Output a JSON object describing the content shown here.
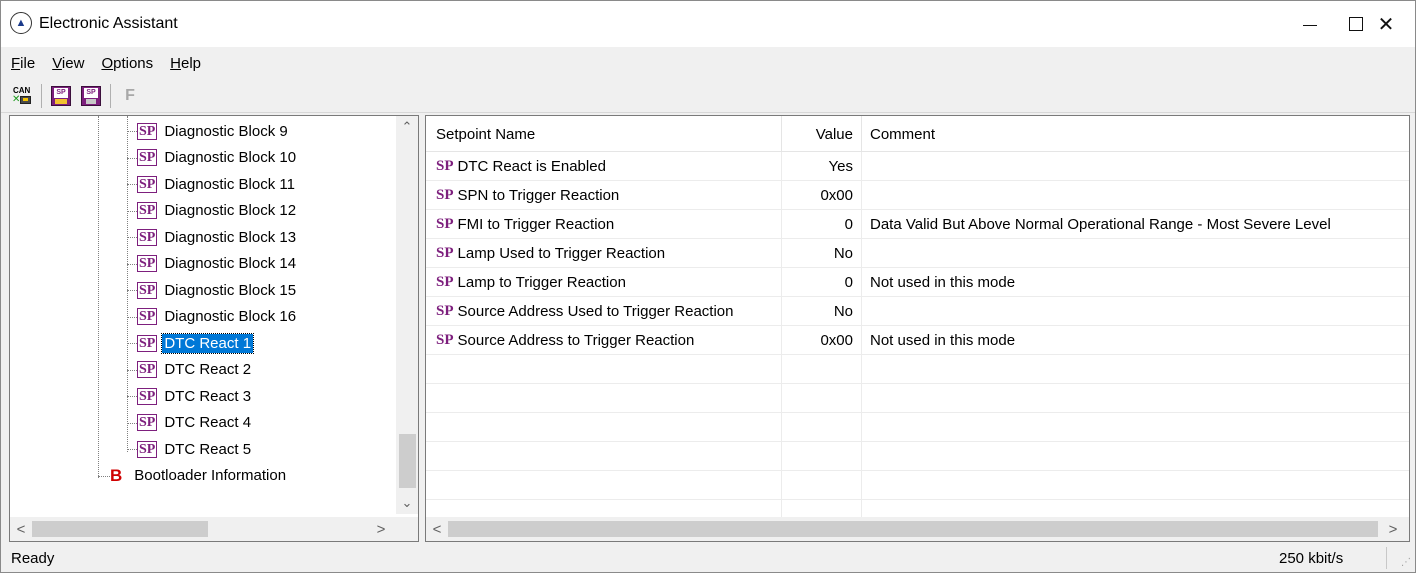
{
  "window": {
    "title": "Electronic Assistant",
    "min_glyph": "",
    "close_glyph": "✕"
  },
  "menu": [
    {
      "u": "F",
      "rest": "ile"
    },
    {
      "u": "V",
      "rest": "iew"
    },
    {
      "u": "O",
      "rest": "ptions"
    },
    {
      "u": "H",
      "rest": "elp"
    }
  ],
  "toolbar": {
    "can_label": "CAN",
    "sp_label": "SP",
    "f_label": "F"
  },
  "tree": {
    "sp_badge": "SP",
    "b_badge": "B",
    "items": [
      {
        "label": "Diagnostic Block 9"
      },
      {
        "label": "Diagnostic Block 10"
      },
      {
        "label": "Diagnostic Block 11"
      },
      {
        "label": "Diagnostic Block 12"
      },
      {
        "label": "Diagnostic Block 13"
      },
      {
        "label": "Diagnostic Block 14"
      },
      {
        "label": "Diagnostic Block 15"
      },
      {
        "label": "Diagnostic Block 16"
      },
      {
        "label": "DTC React 1"
      },
      {
        "label": "DTC React 2"
      },
      {
        "label": "DTC React 3"
      },
      {
        "label": "DTC React 4"
      },
      {
        "label": "DTC React 5"
      }
    ],
    "selected_index": 8,
    "bootloader_label": "Bootloader Information"
  },
  "grid": {
    "columns": {
      "name": "Setpoint Name",
      "value": "Value",
      "comment": "Comment"
    },
    "sp_badge": "SP",
    "rows": [
      {
        "name": "DTC React is Enabled",
        "value": "Yes",
        "comment": ""
      },
      {
        "name": "SPN to Trigger Reaction",
        "value": "0x00",
        "comment": ""
      },
      {
        "name": "FMI to Trigger Reaction",
        "value": "0",
        "comment": "Data Valid But Above Normal Operational Range - Most Severe Level"
      },
      {
        "name": "Lamp Used to Trigger Reaction",
        "value": "No",
        "comment": ""
      },
      {
        "name": "Lamp to Trigger Reaction",
        "value": "0",
        "comment": "Not used in this mode"
      },
      {
        "name": "Source Address Used to Trigger Reaction",
        "value": "No",
        "comment": ""
      },
      {
        "name": "Source Address to Trigger Reaction",
        "value": "0x00",
        "comment": "Not used in this mode"
      }
    ],
    "empty_rows": 6
  },
  "status": {
    "text": "Ready",
    "rate": "250 kbit/s"
  }
}
